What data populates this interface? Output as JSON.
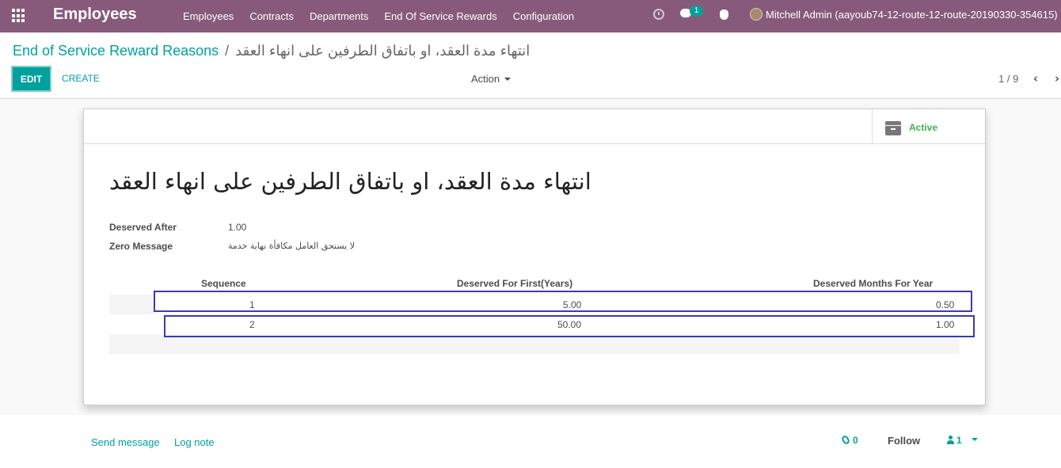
{
  "navbar": {
    "brand": "Employees",
    "menu": [
      "Employees",
      "Contracts",
      "Departments",
      "End Of Service Rewards",
      "Configuration"
    ],
    "chat_badge": "1",
    "user": "Mitchell Admin (aayoub74-12-route-12-route-20190330-354615)",
    "bg_color": "#875a7b"
  },
  "breadcrumb": {
    "parent": "End of Service Reward Reasons",
    "separator": "/",
    "current": "انتهاء مدة العقد، او باتفاق الطرفين على انهاء العقد"
  },
  "toolbar": {
    "edit_label": "EDIT",
    "create_label": "CREATE",
    "action_label": "Action",
    "pager": "1 / 9"
  },
  "form": {
    "status_button": "Active",
    "title": "انتهاء مدة العقد، او باتفاق الطرفين على انهاء العقد",
    "fields": {
      "deserved_after_label": "Deserved After",
      "deserved_after_value": "1.00",
      "zero_message_label": "Zero Message",
      "zero_message_value": "لا يستحق العامل مكافأة نهاية خدمة"
    },
    "table": {
      "headers": [
        "Sequence",
        "Deserved For First(Years)",
        "Deserved Months For Year"
      ],
      "rows": [
        [
          "1",
          "5.00",
          "0.50"
        ],
        [
          "2",
          "50.00",
          "1.00"
        ]
      ]
    }
  },
  "chatter": {
    "send_message": "Send message",
    "log_note": "Log note",
    "attachments": "0",
    "follow": "Follow",
    "followers": "1"
  },
  "colors": {
    "accent": "#00A09D",
    "highlight_box": "#3b3bb0"
  }
}
